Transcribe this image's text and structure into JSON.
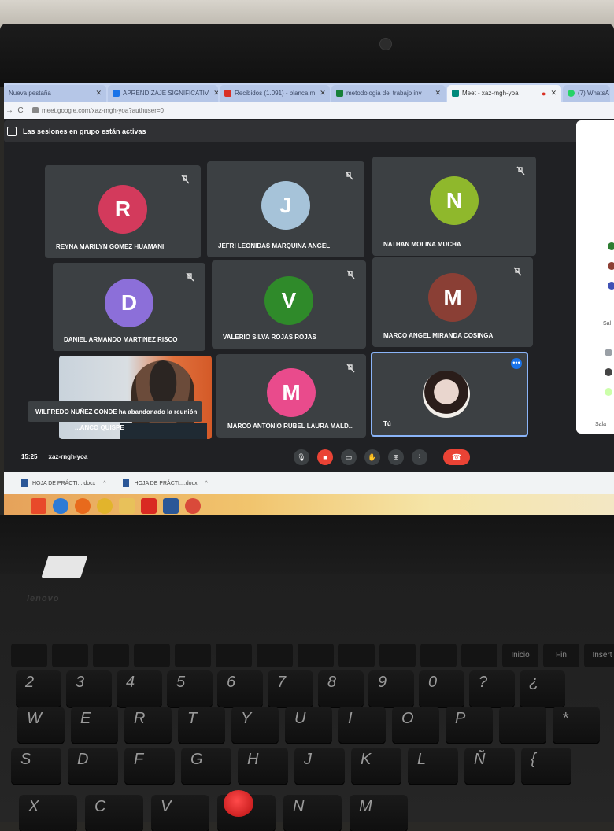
{
  "browser": {
    "tabs": [
      {
        "label": "Nueva pestaña",
        "color": "#5f6368",
        "active": false
      },
      {
        "label": "APRENDIZAJE SIGNIFICATIV",
        "color": "#1a73e8",
        "active": false
      },
      {
        "label": "Recibidos (1.091) - blanca.m",
        "color": "#d93025",
        "active": false
      },
      {
        "label": "metodologia del trabajo inv",
        "color": "#188038",
        "active": false
      },
      {
        "label": "Meet - xaz-rngh-yoa",
        "color": "#00897b",
        "active": true
      },
      {
        "label": "(7) WhatsA",
        "color": "#25d366",
        "active": false
      }
    ],
    "url": "meet.google.com/xaz-rngh-yoa?authuser=0"
  },
  "meet": {
    "banner": "Las sesiones en grupo están activas",
    "participants": [
      {
        "name": "REYNA MARILYN GOMEZ HUAMANI",
        "initial": "R",
        "color": "#d33a5c"
      },
      {
        "name": "JEFRI LEONIDAS MARQUINA ANGEL",
        "initial": "J",
        "color": "#a6c3d9"
      },
      {
        "name": "NATHAN MOLINA MUCHA",
        "initial": "N",
        "color": "#8fb82c"
      },
      {
        "name": "DANIEL ARMANDO MARTINEZ RISCO",
        "initial": "D",
        "color": "#8c6fd9"
      },
      {
        "name": "VALERIO SILVA ROJAS ROJAS",
        "initial": "V",
        "color": "#2f8a2a"
      },
      {
        "name": "MARCO ANGEL MIRANDA COSINGA",
        "initial": "M",
        "color": "#8a3f35"
      },
      {
        "name": "MARCO ANTONIO RUBEL LAURA MALD...",
        "initial": "M",
        "color": "#e94b8c"
      }
    ],
    "video_tile_name": "...ANCO QUISPE",
    "self_label": "Tú",
    "notification": "WILFREDO NUÑEZ CONDE ha abandonado la reunión",
    "time": "15:25",
    "meeting_code": "xaz-rngh-yoa",
    "separator": "|"
  },
  "side_panel": {
    "labels": [
      "Sal",
      "Sala"
    ]
  },
  "downloads": [
    {
      "label": "HOJA DE PRÁCTI....docx"
    },
    {
      "label": "HOJA DE PRÁCTI....docx"
    }
  ],
  "taskbar": {
    "icons": [
      {
        "name": "windows-start-icon",
        "color": "#e84a2a"
      },
      {
        "name": "internet-explorer-icon",
        "color": "#2f7bd6"
      },
      {
        "name": "firefox-icon",
        "color": "#e86a1c"
      },
      {
        "name": "chrome-icon",
        "color": "#e2b42c"
      },
      {
        "name": "file-explorer-icon",
        "color": "#e8c15a"
      },
      {
        "name": "acrobat-icon",
        "color": "#d92a22"
      },
      {
        "name": "word-icon",
        "color": "#2b5797"
      },
      {
        "name": "chrome-app-icon",
        "color": "#d94a3a"
      }
    ]
  },
  "laptop": {
    "brand": "lenovo",
    "fkeys": [
      " ",
      " ",
      " ",
      " ",
      " ",
      " ",
      " ",
      " ",
      " ",
      " ",
      " ",
      " ",
      "Inicio",
      "Fin",
      "Insert"
    ],
    "row_numbers": [
      "2",
      "3",
      "4",
      "5",
      "6",
      "7",
      "8",
      "9",
      "0",
      "?",
      "¿"
    ],
    "row_qwerty": [
      "W",
      "E",
      "R",
      "T",
      "Y",
      "U",
      "I",
      "O",
      "P",
      "",
      "*"
    ],
    "row_asdf": [
      "S",
      "D",
      "F",
      "G",
      "H",
      "J",
      "K",
      "L",
      "Ñ",
      "{"
    ],
    "row_bottom": [
      "X",
      "C",
      "V",
      "",
      "N",
      "M"
    ]
  }
}
